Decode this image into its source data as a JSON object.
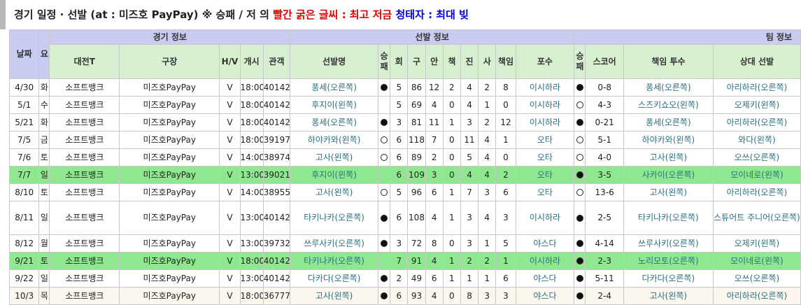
{
  "title": {
    "part1": "경기 일정 · 선발 (at : 미즈호 PayPay) ※ 승패 / 저 의 ",
    "red": "빨간 굵은 글씨 : 최고 저금",
    "gap": " ",
    "blue": "청태자 : 최대 빚"
  },
  "headers": {
    "date": "날짜",
    "day": "요",
    "group_game": "경기 정보",
    "group_starter": "선발 정보",
    "group_team": "팀 정보",
    "opponent": "대전T",
    "stadium": "구장",
    "hv": "H/V",
    "start": "개시",
    "attendance": "관객",
    "starter": "선발명",
    "wl_a": "승패",
    "innings": "회",
    "pitches": "구",
    "hits": "안",
    "runs": "책",
    "strikeouts": "진",
    "walks": "사",
    "earned": "책임",
    "catcher": "포수",
    "wl_b": "승패",
    "score": "스코어",
    "resp_pitcher": "책임 투수",
    "opp_starter": "상대 선발"
  },
  "rows": [
    {
      "date": "4/30",
      "day": "화",
      "opp": "소프트뱅크",
      "stadium": "미즈호PayPay",
      "hv": "V",
      "start": "18:00",
      "att": "40142",
      "starter": "퐁세(오른쪽)",
      "wl": "win",
      "inn": "5",
      "pitch": "86",
      "hits": "12",
      "r": "2",
      "k": "4",
      "bb": "2",
      "er": "8",
      "catcher": "이시하라",
      "twl": "win",
      "score": "0-8",
      "resp": "퐁세(오른쪽)",
      "oppsp": "아리하라(오른쪽)"
    },
    {
      "date": "5/1",
      "day": "수",
      "opp": "소프트뱅크",
      "stadium": "미즈호PayPay",
      "hv": "V",
      "start": "18:00",
      "att": "40142",
      "starter": "후지이(왼쪽)",
      "wl": "",
      "inn": "5",
      "pitch": "69",
      "hits": "4",
      "r": "0",
      "k": "4",
      "bb": "1",
      "er": "0",
      "catcher": "이시하라",
      "twl": "loss",
      "score": "4-3",
      "resp": "스즈키쇼오(왼쪽)",
      "oppsp": "오제키(왼쪽)"
    },
    {
      "date": "5/21",
      "day": "화",
      "opp": "소프트뱅크",
      "stadium": "미즈호PayPay",
      "hv": "V",
      "start": "18:00",
      "att": "40142",
      "starter": "퐁세(오른쪽)",
      "wl": "win",
      "inn": "3",
      "pitch": "81",
      "hits": "11",
      "r": "1",
      "k": "3",
      "bb": "2",
      "er": "12",
      "catcher": "이시하라",
      "twl": "win",
      "score": "0-21",
      "resp": "퐁세(오른쪽)",
      "oppsp": "아리하라(오른쪽)"
    },
    {
      "date": "7/5",
      "day": "금",
      "opp": "소프트뱅크",
      "stadium": "미즈호PayPay",
      "hv": "V",
      "start": "18:00",
      "att": "39197",
      "starter": "하야카와(왼쪽)",
      "wl": "loss",
      "inn": "6",
      "pitch": "118",
      "hits": "7",
      "r": "0",
      "k": "11",
      "bb": "4",
      "er": "1",
      "catcher": "오타",
      "twl": "loss",
      "score": "5-1",
      "resp": "하야카와(왼쪽)",
      "oppsp": "와다(왼쪽)"
    },
    {
      "date": "7/6",
      "day": "토",
      "opp": "소프트뱅크",
      "stadium": "미즈호PayPay",
      "hv": "V",
      "start": "14:00",
      "att": "38974",
      "starter": "고사(왼쪽)",
      "wl": "loss",
      "inn": "6",
      "pitch": "89",
      "hits": "2",
      "r": "0",
      "k": "5",
      "bb": "4",
      "er": "0",
      "catcher": "오타",
      "twl": "loss",
      "score": "4-0",
      "resp": "고사(왼쪽)",
      "oppsp": "오쓰(오른쪽)"
    },
    {
      "date": "7/7",
      "day": "일",
      "opp": "소프트뱅크",
      "stadium": "미즈호PayPay",
      "hv": "V",
      "start": "13:00",
      "att": "39021",
      "starter": "후지이(왼쪽)",
      "wl": "",
      "inn": "6",
      "pitch": "109",
      "hits": "3",
      "r": "0",
      "k": "4",
      "bb": "4",
      "er": "2",
      "catcher": "오타",
      "twl": "win",
      "score": "3-5",
      "resp": "사카이(오른쪽)",
      "oppsp": "모이네로(왼쪽)",
      "hl": true
    },
    {
      "date": "8/10",
      "day": "토",
      "opp": "소프트뱅크",
      "stadium": "미즈호PayPay",
      "hv": "V",
      "start": "14:00",
      "att": "38955",
      "starter": "고사(왼쪽)",
      "wl": "loss",
      "inn": "5",
      "pitch": "96",
      "hits": "6",
      "r": "1",
      "k": "7",
      "bb": "3",
      "er": "6",
      "catcher": "오타",
      "twl": "loss",
      "score": "13-6",
      "resp": "고사(왼쪽)",
      "oppsp": "아리하라(오른쪽)"
    },
    {
      "date": "8/11",
      "day": "일",
      "opp": "소프트뱅크",
      "stadium": "미즈호PayPay",
      "hv": "V",
      "start": "13:00",
      "att": "40142",
      "starter": "타키나카(오른쪽)",
      "wl": "win",
      "inn": "6",
      "pitch": "108",
      "hits": "4",
      "r": "1",
      "k": "3",
      "bb": "4",
      "er": "3",
      "catcher": "이시하라",
      "twl": "win",
      "score": "2-5",
      "resp": "타키나카(오른쪽)",
      "oppsp": "스튜어트 주니어(오른쪽)",
      "tall": true
    },
    {
      "date": "8/12",
      "day": "월",
      "opp": "소프트뱅크",
      "stadium": "미즈호PayPay",
      "hv": "V",
      "start": "13:00",
      "att": "39732",
      "starter": "쓰루사키(오른쪽)",
      "wl": "win",
      "inn": "3",
      "pitch": "72",
      "hits": "8",
      "r": "0",
      "k": "3",
      "bb": "1",
      "er": "5",
      "catcher": "야스다",
      "twl": "win",
      "score": "4-14",
      "resp": "쓰루사키(오른쪽)",
      "oppsp": "오제키(왼쪽)"
    },
    {
      "date": "9/21",
      "day": "토",
      "opp": "소프트뱅크",
      "stadium": "미즈호PayPay",
      "hv": "V",
      "start": "18:00",
      "att": "40142",
      "starter": "타키나카(오른쪽)",
      "wl": "",
      "inn": "7",
      "pitch": "91",
      "hits": "4",
      "r": "1",
      "k": "2",
      "bb": "2",
      "er": "1",
      "catcher": "이시하라",
      "twl": "win",
      "score": "2-3",
      "resp": "노리모토(오른쪽)",
      "oppsp": "모이네로(왼쪽)",
      "hl": true
    },
    {
      "date": "9/22",
      "day": "일",
      "opp": "소프트뱅크",
      "stadium": "미즈호PayPay",
      "hv": "V",
      "start": "13:00",
      "att": "40142",
      "starter": "다카다(오른쪽)",
      "wl": "win",
      "inn": "2",
      "pitch": "49",
      "hits": "6",
      "r": "1",
      "k": "1",
      "bb": "1",
      "er": "6",
      "catcher": "야스다",
      "twl": "win",
      "score": "5-11",
      "resp": "다카다(오른쪽)",
      "oppsp": "오쓰(오른쪽)"
    },
    {
      "date": "10/3",
      "day": "목",
      "opp": "소프트뱅크",
      "stadium": "미즈호PayPay",
      "hv": "V",
      "start": "18:00",
      "att": "36777",
      "starter": "고사(왼쪽)",
      "wl": "win",
      "inn": "6",
      "pitch": "93",
      "hits": "4",
      "r": "0",
      "k": "8",
      "bb": "3",
      "er": "3",
      "catcher": "야스다",
      "twl": "win",
      "score": "2-4",
      "resp": "고사(왼쪽)",
      "oppsp": "아리하라(오른쪽)",
      "last": true
    }
  ]
}
